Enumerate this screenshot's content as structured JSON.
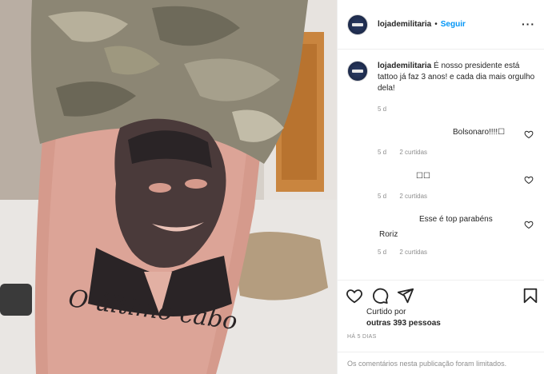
{
  "post": {
    "username": "lojademilitaria",
    "dot": "•",
    "follow_label": "Seguir",
    "more_label": "···",
    "caption_user": "lojademilitaria",
    "caption_text": "É nosso presidente está tattoo já faz 3 anos! e cada dia mais orgulho dela!",
    "caption_time": "5 d",
    "photo_text": "O último cabo"
  },
  "comments": [
    {
      "text": "Bolsonaro!!!!☐",
      "time": "5 d",
      "likes": "2 curtidas"
    },
    {
      "text": "☐☐",
      "time": "5 d",
      "likes": "2 curtidas"
    },
    {
      "text": "Esse é top parabéns",
      "text2": "Roriz",
      "time": "5 d",
      "likes": "2 curtidas"
    }
  ],
  "footer": {
    "liked_by": "Curtido por",
    "others": "outras 393 pessoas",
    "posted": "HÁ 5 DIAS",
    "limited": "Os comentários nesta publicação foram limitados."
  },
  "colors": {
    "link": "#0095f6",
    "muted": "#8e8e8e",
    "text": "#262626"
  },
  "icons": [
    "heart-icon",
    "comment-icon",
    "share-icon",
    "bookmark-icon",
    "more-icon"
  ]
}
